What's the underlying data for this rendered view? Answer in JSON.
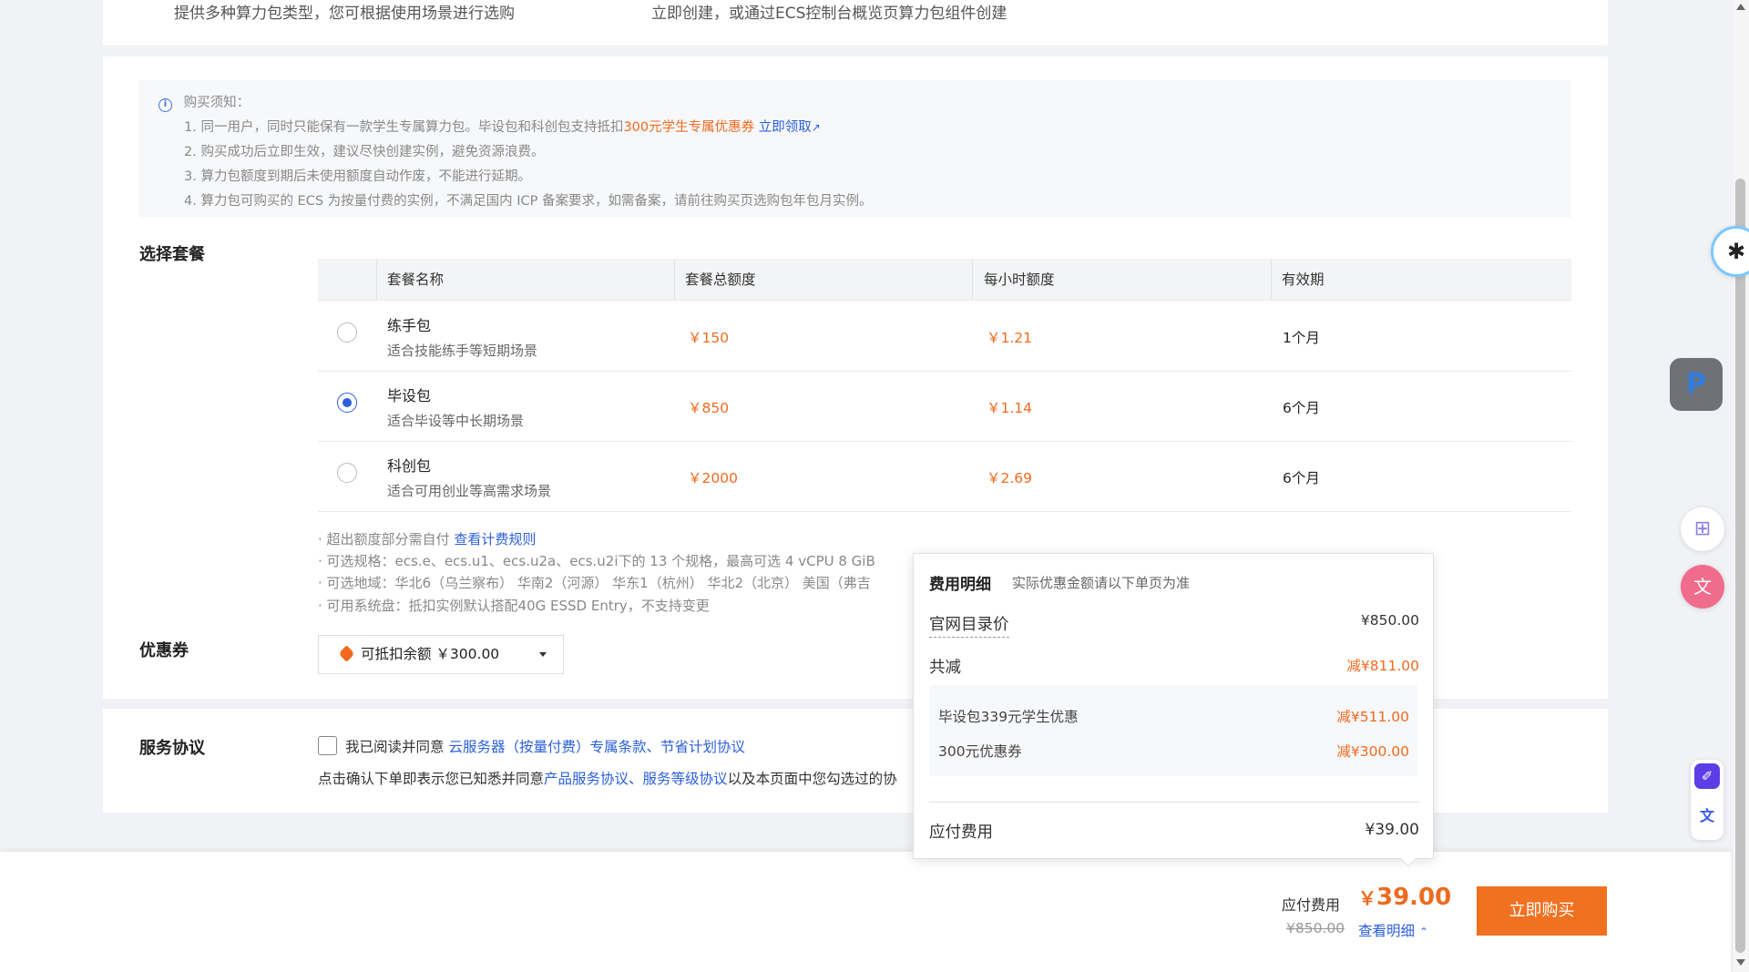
{
  "top": {
    "left_text": "提供多种算力包类型，您可根据使用场景进行选购",
    "right_text": "立即创建，或通过ECS控制台概览页算力包组件创建"
  },
  "notice": {
    "title": "购买须知：",
    "item1_prefix": "1. 同一用户，同时只能保有一款学生专属算力包。毕设包和科创包支持抵扣",
    "item1_highlight": "300元学生专属优惠券",
    "item1_link": "立即领取",
    "item2": "2. 购买成功后立即生效，建议尽快创建实例，避免资源浪费。",
    "item3": "3. 算力包额度到期后未使用额度自动作废，不能进行延期。",
    "item4": "4. 算力包可购买的 ECS 为按量付费的实例，不满足国内 ICP 备案要求，如需备案，请前往购买页选购包年包月实例。"
  },
  "package": {
    "section_label": "选择套餐",
    "headers": [
      "套餐名称",
      "套餐总额度",
      "每小时额度",
      "有效期"
    ],
    "rows": [
      {
        "name": "练手包",
        "desc": "适合技能练手等短期场景",
        "total": "￥150",
        "hourly": "￥1.21",
        "validity": "1个月",
        "selected": false
      },
      {
        "name": "毕设包",
        "desc": "适合毕设等中长期场景",
        "total": "￥850",
        "hourly": "￥1.14",
        "validity": "6个月",
        "selected": true
      },
      {
        "name": "科创包",
        "desc": "适合可用创业等高需求场景",
        "total": "￥2000",
        "hourly": "￥2.69",
        "validity": "6个月",
        "selected": false
      }
    ],
    "spec1_prefix": "· 超出额度部分需自付",
    "spec1_link": "查看计费规则",
    "spec2": "· 可选规格：ecs.e、ecs.u1、ecs.u2a、ecs.u2i下的 13 个规格，最高可选 4 vCPU 8 GiB",
    "spec3": "· 可选地域：华北6（乌兰察布） 华南2（河源） 华东1（杭州） 华北2（北京） 美国（弗吉",
    "spec4": "· 可用系统盘：抵扣实例默认搭配40G ESSD Entry，不支持变更"
  },
  "coupon": {
    "section_label": "优惠券",
    "value": "可抵扣余额 ￥300.00"
  },
  "service": {
    "section_label": "服务协议",
    "agree_prefix": "我已阅读并同意",
    "agree_link1": "云服务器（按量付费）专属条款",
    "agree_sep": "、",
    "agree_link2": "节省计划协议",
    "confirm_prefix": "点击确认下单即表示您已知悉并同意",
    "confirm_link1": "产品服务协议",
    "confirm_sep": "、",
    "confirm_link2": "服务等级协议",
    "confirm_suffix": "以及本页面中您勾选过的协"
  },
  "popover": {
    "title": "费用明细",
    "subtitle": "实际优惠金额请以下单页为准",
    "list_price_label": "官网目录价",
    "list_price": "¥850.00",
    "total_discount_label": "共减",
    "total_discount": "减¥811.00",
    "discounts": [
      {
        "label": "毕设包339元学生优惠",
        "value": "减¥511.00"
      },
      {
        "label": "300元优惠券",
        "value": "减¥300.00"
      }
    ],
    "payable_label": "应付费用",
    "payable": "¥39.00"
  },
  "bottom": {
    "payable_label": "应付费用",
    "currency": "￥",
    "amount": "39.00",
    "original_price": "¥850.00",
    "detail_link": "查看明细",
    "buy_button": "立即购买"
  },
  "colors": {
    "accent_orange": "#ef6a1e",
    "link_blue": "#2b5fd9",
    "button_orange": "#f0711f"
  }
}
